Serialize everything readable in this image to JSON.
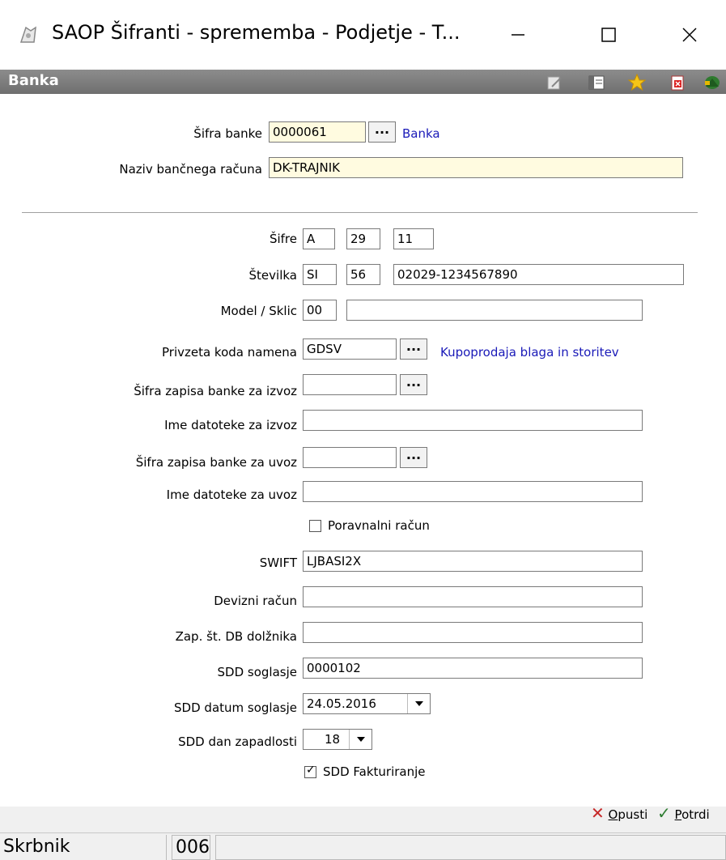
{
  "window": {
    "title": "SAOP Šifranti - sprememba - Podjetje - T...",
    "min_icon": "minimize-icon",
    "max_icon": "maximize-icon",
    "close_icon": "close-icon"
  },
  "header": {
    "title": "Banka",
    "toolbar_icons": [
      "edit-icon",
      "columns-icon",
      "star-icon",
      "delete-icon",
      "exit-icon"
    ]
  },
  "form": {
    "sifra_banke": {
      "label": "Šifra banke",
      "value": "0000061",
      "link": "Banka"
    },
    "naziv": {
      "label": "Naziv bančnega računa",
      "value": "DK-TRAJNIK"
    },
    "sifre": {
      "label": "Šifre",
      "v1": "A",
      "v2": "29",
      "v3": "11"
    },
    "stevilka": {
      "label": "Številka",
      "v1": "SI",
      "v2": "56",
      "v3": "02029-1234567890"
    },
    "model": {
      "label": "Model / Sklic",
      "v1": "00",
      "v2": ""
    },
    "koda_namena": {
      "label": "Privzeta koda namena",
      "value": "GDSV",
      "link": "Kupoprodaja blaga in storitev"
    },
    "izvoz_sifra": {
      "label": "Šifra zapisa banke za izvoz",
      "value": ""
    },
    "izvoz_ime": {
      "label": "Ime datoteke za izvoz",
      "value": ""
    },
    "uvoz_sifra": {
      "label": "Šifra zapisa banke za uvoz",
      "value": ""
    },
    "uvoz_ime": {
      "label": "Ime datoteke za uvoz",
      "value": ""
    },
    "poravnalni": {
      "label": "Poravnalni račun",
      "checked": false
    },
    "swift": {
      "label": "SWIFT",
      "value": "LJBASI2X"
    },
    "devizni": {
      "label": "Devizni račun",
      "value": ""
    },
    "zap_st": {
      "label": "Zap. št. DB dolžnika",
      "value": ""
    },
    "sdd_soglasje": {
      "label": "SDD soglasje",
      "value": "0000102"
    },
    "sdd_datum": {
      "label": "SDD datum soglasje",
      "value": "24.05.2016"
    },
    "sdd_dan": {
      "label": "SDD dan zapadlosti",
      "value": "18"
    },
    "sdd_fakturiranje": {
      "label": "SDD Fakturiranje",
      "checked": true
    },
    "dots_label": "..."
  },
  "footer": {
    "cancel": {
      "rest": "pusti",
      "key": "O"
    },
    "confirm": {
      "rest": "otrdi",
      "key": "P"
    }
  },
  "status": {
    "user": "Skrbnik",
    "code": "006",
    "extra": ""
  },
  "colors": {
    "link": "#1a1ab8",
    "header_bg": "#7a7a7a",
    "yellow_input": "#fffbe0"
  }
}
